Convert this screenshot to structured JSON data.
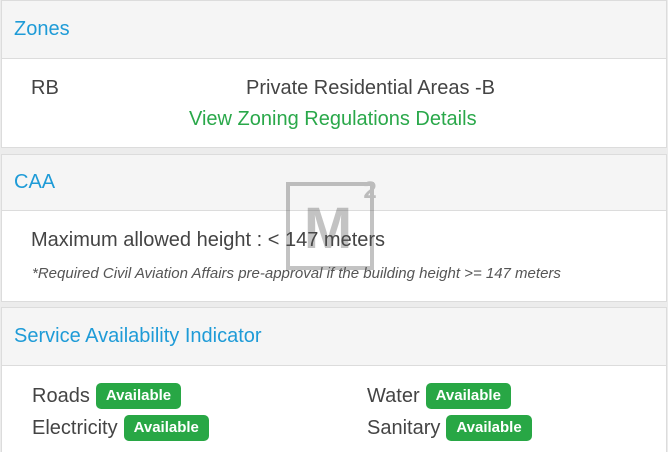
{
  "zones": {
    "title": "Zones",
    "code": "RB",
    "description": "Private Residential Areas -B",
    "link": "View Zoning Regulations Details"
  },
  "caa": {
    "title": "CAA",
    "max_height": "Maximum allowed height : < 147 meters",
    "note": "*Required Civil Aviation Affairs pre-approval if the building height >= 147 meters"
  },
  "service": {
    "title": "Service Availability Indicator",
    "items": [
      {
        "label": "Roads",
        "status": "Available"
      },
      {
        "label": "Water",
        "status": "Available"
      },
      {
        "label": "Electricity",
        "status": "Available"
      },
      {
        "label": "Sanitary",
        "status": "Available"
      }
    ]
  },
  "colors": {
    "heading": "#1e9bd7",
    "link": "#2aa84a",
    "badge": "#28a745"
  },
  "watermark": {
    "text": "M",
    "superscript": "2"
  }
}
